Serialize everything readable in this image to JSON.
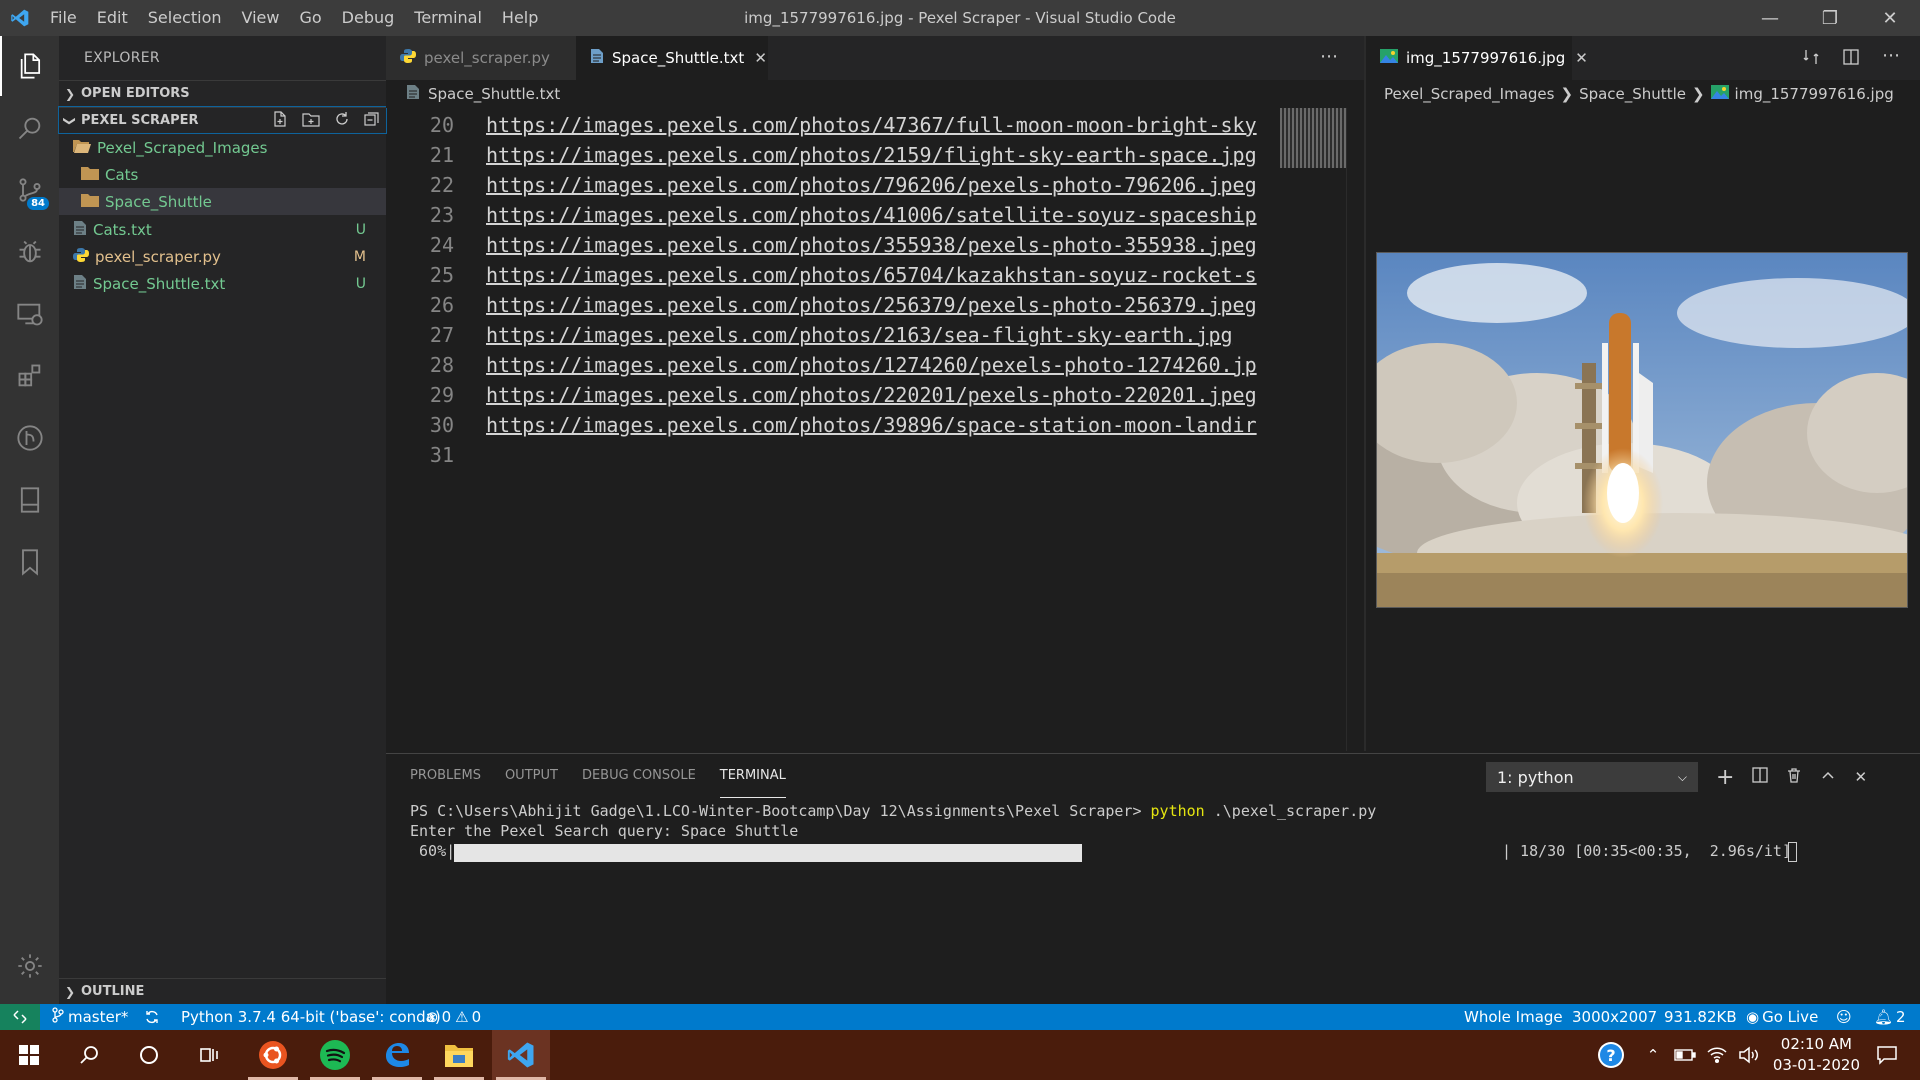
{
  "window": {
    "title": "img_1577997616.jpg - Pexel Scraper - Visual Studio Code",
    "menu": [
      "File",
      "Edit",
      "Selection",
      "View",
      "Go",
      "Debug",
      "Terminal",
      "Help"
    ]
  },
  "activity_bar": {
    "items": [
      "explorer-icon",
      "search-icon",
      "source-control-icon",
      "debug-icon",
      "remote-explorer-icon",
      "extensions-icon",
      "git-graph-icon",
      "bookmark-panel-icon",
      "bookmark-icon"
    ],
    "source_control_badge": "84"
  },
  "sidebar": {
    "title": "EXPLORER",
    "open_editors_label": "OPEN EDITORS",
    "project_label": "PEXEL SCRAPER",
    "tree": [
      {
        "label": "Pexel_Scraped_Images",
        "type": "folder",
        "status": "dot",
        "color": "#73c991"
      },
      {
        "label": "Cats",
        "type": "folder",
        "status": "dot",
        "color": "#73c991"
      },
      {
        "label": "Space_Shuttle",
        "type": "folder",
        "status": "dot",
        "color": "#73c991"
      },
      {
        "label": "Cats.txt",
        "type": "file",
        "status": "U",
        "color": "#73c991"
      },
      {
        "label": "pexel_scraper.py",
        "type": "python",
        "status": "M",
        "color": "#e2c08d"
      },
      {
        "label": "Space_Shuttle.txt",
        "type": "file",
        "status": "U",
        "color": "#73c991"
      }
    ],
    "outline_label": "OUTLINE"
  },
  "editor1": {
    "tabs": [
      {
        "label": "pexel_scraper.py",
        "active": false
      },
      {
        "label": "Space_Shuttle.txt",
        "active": true
      }
    ],
    "breadcrumb": "Space_Shuttle.txt",
    "lines": [
      {
        "n": "20",
        "text": "https://images.pexels.com/photos/47367/full-moon-moon-bright-sky"
      },
      {
        "n": "21",
        "text": "https://images.pexels.com/photos/2159/flight-sky-earth-space.jpg"
      },
      {
        "n": "22",
        "text": "https://images.pexels.com/photos/796206/pexels-photo-796206.jpeg"
      },
      {
        "n": "23",
        "text": "https://images.pexels.com/photos/41006/satellite-soyuz-spaceship"
      },
      {
        "n": "24",
        "text": "https://images.pexels.com/photos/355938/pexels-photo-355938.jpeg"
      },
      {
        "n": "25",
        "text": "https://images.pexels.com/photos/65704/kazakhstan-soyuz-rocket-s"
      },
      {
        "n": "26",
        "text": "https://images.pexels.com/photos/256379/pexels-photo-256379.jpeg"
      },
      {
        "n": "27",
        "text": "https://images.pexels.com/photos/2163/sea-flight-sky-earth.jpg"
      },
      {
        "n": "28",
        "text": "https://images.pexels.com/photos/1274260/pexels-photo-1274260.jp"
      },
      {
        "n": "29",
        "text": "https://images.pexels.com/photos/220201/pexels-photo-220201.jpeg"
      },
      {
        "n": "30",
        "text": "https://images.pexels.com/photos/39896/space-station-moon-landir"
      },
      {
        "n": "31",
        "text": ""
      }
    ]
  },
  "editor2": {
    "tab": "img_1577997616.jpg",
    "breadcrumb": [
      "Pexel_Scraped_Images",
      "Space_Shuttle",
      "img_1577997616.jpg"
    ]
  },
  "panel": {
    "tabs": [
      "PROBLEMS",
      "OUTPUT",
      "DEBUG CONSOLE",
      "TERMINAL"
    ],
    "terminal_select": "1: python",
    "prompt": "PS C:\\Users\\Abhijit Gadge\\1.LCO-Winter-Bootcamp\\Day 12\\Assignments\\Pexel Scraper> ",
    "command": "python",
    "command_args": " .\\pexel_scraper.py",
    "query_line": "Enter the Pexel Search query: Space Shuttle",
    "progress_percent_label": " 60%|",
    "progress_fraction": 0.6,
    "progress_tail": "| 18/30 [00:35<00:35,  2.96s/it]"
  },
  "statusbar": {
    "branch": "master*",
    "python": "Python 3.7.4 64-bit ('base': conda)",
    "errors": "0",
    "warnings": "0",
    "whole_image": "Whole Image",
    "dimensions": "3000x2007",
    "filesize": "931.82KB",
    "golive": "Go Live",
    "notifications": "2"
  },
  "taskbar": {
    "time": "02:10 AM",
    "date": "03-01-2020"
  },
  "colors": {
    "accent": "#007acc",
    "untracked": "#73c991",
    "modified": "#e2c08d",
    "terminal_command": "#e5e510"
  }
}
